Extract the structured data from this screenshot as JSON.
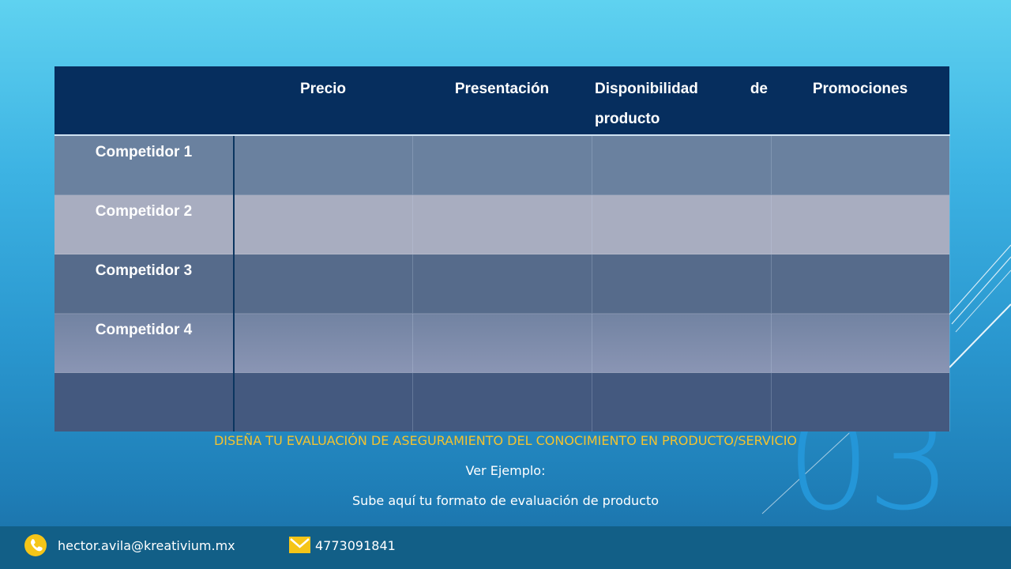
{
  "table": {
    "headers": [
      "",
      "Precio",
      "Presentación",
      "Disponibilidad  de producto",
      "Promociones"
    ],
    "rows": [
      "Competidor  1",
      "Competidor  2",
      "Competidor  3",
      "Competidor  4",
      ""
    ]
  },
  "slide_number": "03",
  "instructions": {
    "title": "DISEÑA TU EVALUACIÓN DE ASEGURAMIENTO  DEL CONOCIMIENTO  EN PRODUCTO/SERVICIO",
    "example": "Ver Ejemplo:",
    "upload": "Sube aquí tu formato de evaluación de producto"
  },
  "footer": {
    "email": "hector.avila@kreativium.mx",
    "phone": "4773091841",
    "icons": [
      "phone-icon",
      "mail-icon"
    ]
  },
  "colors": {
    "header": "#062e5e",
    "accent_text": "#f2c230",
    "footer": "#125f87"
  }
}
